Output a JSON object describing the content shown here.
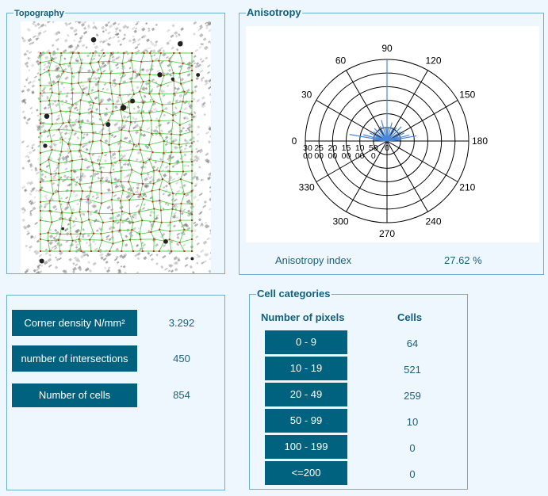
{
  "topography": {
    "title": "Topography"
  },
  "anisotropy": {
    "title": "Anisotropy",
    "index_label": "Anisotropy index",
    "index_value": "27.62 %",
    "chart_data": {
      "type": "polar",
      "angle_labels": [
        "0",
        "30",
        "60",
        "90",
        "120",
        "150",
        "180",
        "210",
        "240",
        "270",
        "300",
        "330"
      ],
      "radial_tick_labels": [
        "30\n00",
        "25\n00",
        "20\n00",
        "15\n00",
        "10\n00",
        "50\n0",
        "0"
      ],
      "radial_max": 3000,
      "rings": 6,
      "series_color": "#4a86d8",
      "rays": [
        {
          "angle": 90,
          "value": 3000
        },
        {
          "angle": 10,
          "value": 1400
        },
        {
          "angle": 170,
          "value": 1100
        },
        {
          "angle": 15,
          "value": 900
        },
        {
          "angle": 165,
          "value": 850
        },
        {
          "angle": 25,
          "value": 700
        },
        {
          "angle": 155,
          "value": 700
        },
        {
          "angle": 35,
          "value": 600
        },
        {
          "angle": 145,
          "value": 600
        },
        {
          "angle": 45,
          "value": 650
        },
        {
          "angle": 135,
          "value": 750
        },
        {
          "angle": 55,
          "value": 550
        },
        {
          "angle": 125,
          "value": 600
        },
        {
          "angle": 65,
          "value": 600
        },
        {
          "angle": 115,
          "value": 550
        },
        {
          "angle": 75,
          "value": 800
        },
        {
          "angle": 105,
          "value": 700
        },
        {
          "angle": 85,
          "value": 500
        },
        {
          "angle": 95,
          "value": 500
        },
        {
          "angle": 5,
          "value": 500
        },
        {
          "angle": 175,
          "value": 500
        },
        {
          "angle": 20,
          "value": 450
        },
        {
          "angle": 160,
          "value": 450
        }
      ]
    }
  },
  "stats": {
    "items": [
      {
        "label": "Corner density N/mm²",
        "value": "3.292"
      },
      {
        "label": "number of intersections",
        "value": "450"
      },
      {
        "label": "Number of cells",
        "value": "854"
      }
    ]
  },
  "cell_categories": {
    "title": "Cell categories",
    "col_pixels": "Number of pixels",
    "col_cells": "Cells",
    "rows": [
      {
        "range": "0 - 9",
        "cells": "64"
      },
      {
        "range": "10 - 19",
        "cells": "521"
      },
      {
        "range": "20 - 49",
        "cells": "259"
      },
      {
        "range": "50 - 99",
        "cells": "10"
      },
      {
        "range": "100 - 199",
        "cells": "0"
      },
      {
        "range": "<=200",
        "cells": "0"
      }
    ]
  }
}
